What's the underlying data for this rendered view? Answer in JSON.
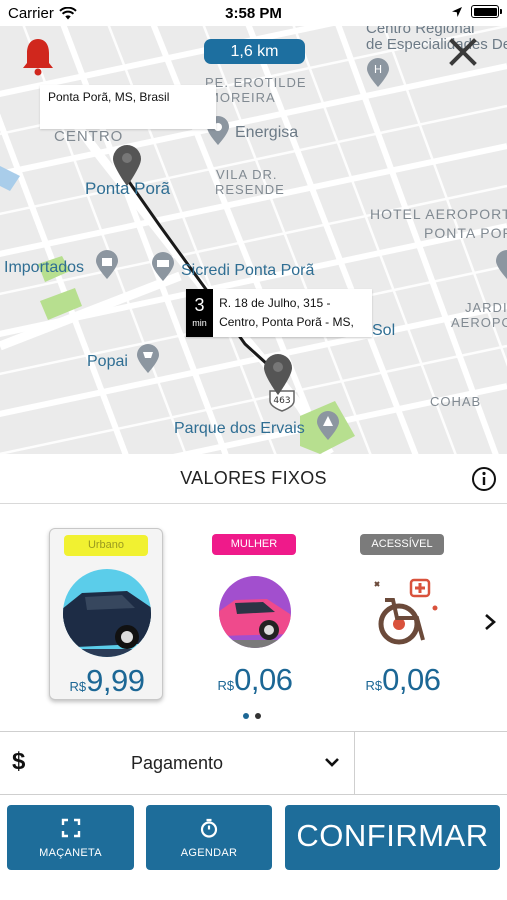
{
  "status_bar": {
    "carrier": "Carrier",
    "time": "3:58 PM"
  },
  "map": {
    "distance": "1,6 km",
    "origin_label": "Ponta Porã, MS, Brasil",
    "eta": {
      "minutes": "3",
      "unit": "min",
      "address": "R. 18 de Julho, 315 - Centro, Ponta Porã - MS,"
    },
    "labels": {
      "centro_regional": "Centro Regional",
      "especialidades": "de Especialidades De",
      "pe_erotilde": "PE. EROTILDE",
      "moreira": "MOREIRA",
      "centro": "CENTRO",
      "energisa": "Energisa",
      "ponta_pora": "Ponta Porã",
      "vila_dr": "VILA DR.",
      "resende": "RESENDE",
      "hotel_aeroporto": "HOTEL AEROPORTO",
      "ponta_pora_caps": "PONTA PORÃ",
      "importados": "Importados",
      "sicredi": "Sicredi Ponta Porã",
      "jardim": "JARDI",
      "aeroporto": "AEROPO",
      "sol": "Sol",
      "popai": "Popai",
      "cohab": "COHAB",
      "parque": "Parque dos Ervais",
      "route_shield": "463"
    }
  },
  "fixed_values": {
    "title": "VALORES FIXOS",
    "options": [
      {
        "badge": "Urbano",
        "currency": "R$",
        "price": "9,99",
        "badge_bg": "#f1f131",
        "badge_fg": "#9a9a20"
      },
      {
        "badge": "MULHER",
        "currency": "R$",
        "price": "0,06",
        "badge_bg": "#ef1a8a",
        "badge_fg": "#ffffff"
      },
      {
        "badge": "ACESSÍVEL",
        "currency": "R$",
        "price": "0,06",
        "badge_bg": "#7b7b7b",
        "badge_fg": "#ffffff"
      }
    ],
    "page_dots": {
      "count": 2,
      "active": 0,
      "active_color": "#1c6795",
      "inactive_color": "#333333"
    }
  },
  "payment": {
    "currency_symbol": "$",
    "label": "Pagamento"
  },
  "actions": {
    "handle_label": "MAÇANETA",
    "schedule_label": "AGENDAR",
    "confirm_label": "CONFIRMAR"
  },
  "colors": {
    "primary": "#1e6d9a",
    "price": "#1c6795",
    "alert": "#d0271d"
  }
}
